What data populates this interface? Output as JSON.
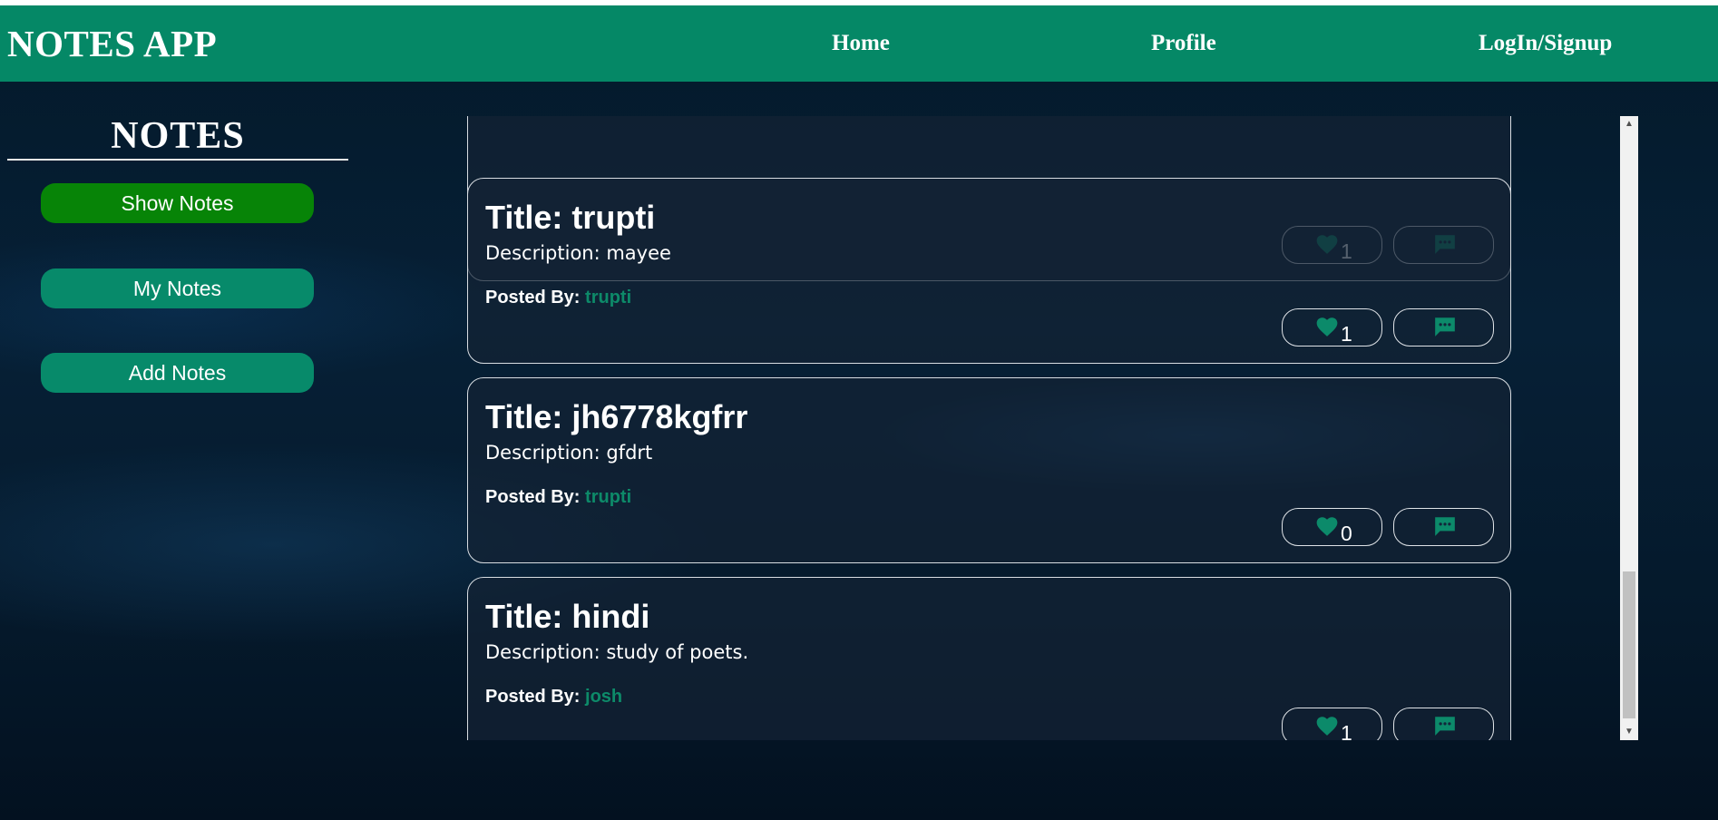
{
  "navbar": {
    "brand": "NOTES APP",
    "links": [
      "Home",
      "Profile",
      "LogIn/Signup"
    ]
  },
  "sidebar": {
    "title": "NOTES",
    "buttons": [
      "Show Notes",
      "My Notes",
      "Add Notes"
    ],
    "active_button": "Show Notes"
  },
  "notes": [
    {
      "title": "",
      "description": "",
      "posted_by_label": "",
      "author": "",
      "likes": "1"
    },
    {
      "title": "Title: trupti",
      "description": "Description: mayee",
      "posted_by_label": "Posted By:",
      "author": "trupti",
      "likes": "1"
    },
    {
      "title": "Title: jh6778kgfrr",
      "description": "Description: gfdrt",
      "posted_by_label": "Posted By:",
      "author": "trupti",
      "likes": "0"
    },
    {
      "title": "Title: hindi",
      "description": "Description: study of poets.",
      "posted_by_label": "Posted By:",
      "author": "josh",
      "likes": "1"
    }
  ],
  "colors": {
    "navbar": "#058866",
    "accent": "#0d8a69",
    "active_button": "#078407",
    "button": "#078a6a"
  },
  "icons": {
    "like": "heart-icon",
    "comment": "comment-dots-icon",
    "scroll_up": "scroll-up-arrow-icon",
    "scroll_down": "scroll-down-arrow-icon"
  }
}
